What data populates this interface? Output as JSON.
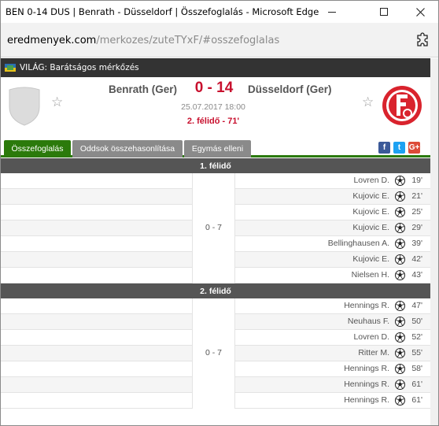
{
  "window": {
    "title": "BEN 0-14 DUS | Benrath - Düsseldorf | Összefoglalás - Microsoft Edge"
  },
  "address": {
    "host": "eredmenyek.com",
    "path": "/merkozes/zuteTYxF/#osszefoglalas"
  },
  "league": {
    "name": "VILÁG: Barátságos mérkőzés"
  },
  "match": {
    "home_team": "Benrath (Ger)",
    "away_team": "Düsseldorf (Ger)",
    "score": "0 - 14",
    "datetime": "25.07.2017 18:00",
    "status": "2. félidő - 71'"
  },
  "tabs": [
    {
      "label": "Összefoglalás"
    },
    {
      "label": "Oddsok összehasonlítása"
    },
    {
      "label": "Egymás elleni"
    }
  ],
  "social": {
    "fb": "f",
    "tw": "t",
    "gp": "G+"
  },
  "halves": [
    {
      "label": "1. félidő",
      "score": "0 - 7",
      "events": [
        {
          "player": "Lovren D.",
          "minute": "19'"
        },
        {
          "player": "Kujovic E.",
          "minute": "21'"
        },
        {
          "player": "Kujovic E.",
          "minute": "25'"
        },
        {
          "player": "Kujovic E.",
          "minute": "29'"
        },
        {
          "player": "Bellinghausen A.",
          "minute": "39'"
        },
        {
          "player": "Kujovic E.",
          "minute": "42'"
        },
        {
          "player": "Nielsen H.",
          "minute": "43'"
        }
      ]
    },
    {
      "label": "2. félidő",
      "score": "0 - 7",
      "events": [
        {
          "player": "Hennings R.",
          "minute": "47'"
        },
        {
          "player": "Neuhaus F.",
          "minute": "50'"
        },
        {
          "player": "Lovren D.",
          "minute": "52'"
        },
        {
          "player": "Ritter M.",
          "minute": "55'"
        },
        {
          "player": "Hennings R.",
          "minute": "58'"
        },
        {
          "player": "Hennings R.",
          "minute": "61'"
        },
        {
          "player": "Hennings R.",
          "minute": "61'"
        }
      ]
    }
  ],
  "colors": {
    "accent_green": "#2b7a0b",
    "score_red": "#c8102e",
    "header_dark": "#333333"
  }
}
